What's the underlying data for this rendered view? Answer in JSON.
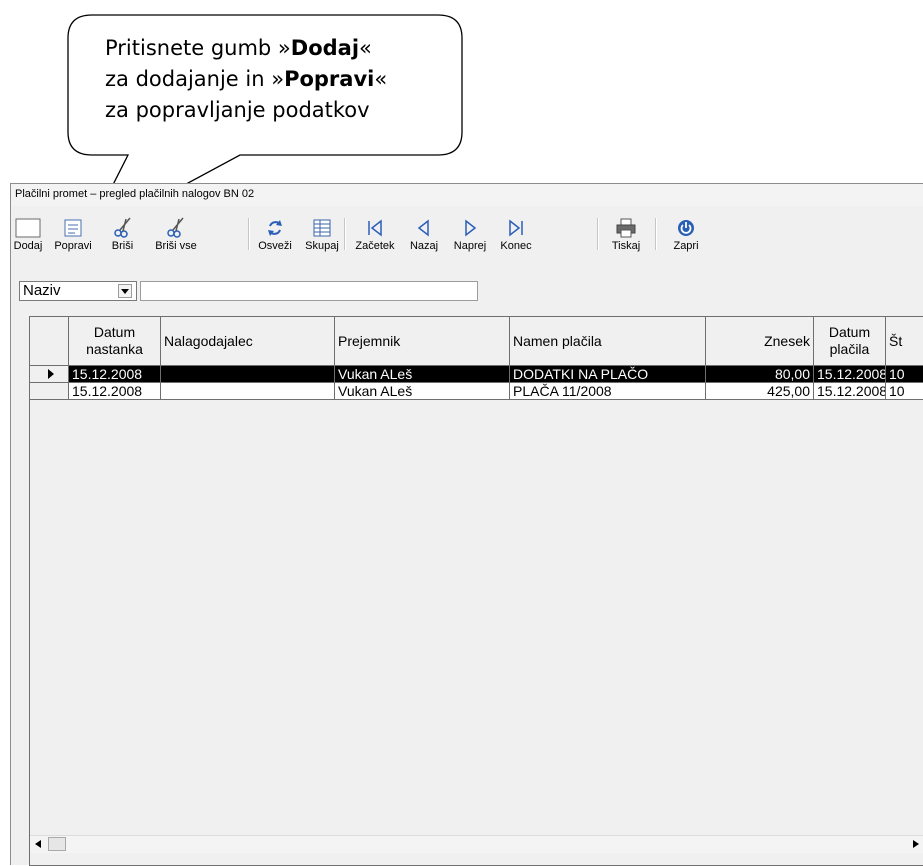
{
  "callout": {
    "line1_pre": "Pritisnete gumb »",
    "line1_bold": "Dodaj",
    "line1_post": "«",
    "line2_pre": "za dodajanje in »",
    "line2_bold": "Popravi",
    "line2_post": "«",
    "line3": "za popravljanje podatkov"
  },
  "window": {
    "title": "Plačilni promet – pregled plačilnih nalogov BN 02"
  },
  "toolbar": {
    "dodaj": "Dodaj",
    "popravi": "Popravi",
    "brisi": "Briši",
    "brisi_vse": "Briši vse",
    "osvezi": "Osveži",
    "skupaj": "Skupaj",
    "zacetek": "Začetek",
    "nazaj": "Nazaj",
    "naprej": "Naprej",
    "konec": "Konec",
    "tiskaj": "Tiskaj",
    "zapri": "Zapri"
  },
  "filter": {
    "field": "Naziv",
    "value": ""
  },
  "grid": {
    "columns": {
      "datum_nastanka_1": "Datum",
      "datum_nastanka_2": "nastanka",
      "nalagodajalec": "Nalagodajalec",
      "prejemnik": "Prejemnik",
      "namen": "Namen plačila",
      "znesek": "Znesek",
      "datum_placila_1": "Datum",
      "datum_placila_2": "plačila",
      "st": "Št"
    },
    "rows": [
      {
        "datum": "15.12.2008",
        "nalagodajalec": "",
        "prejemnik": "Vukan ALeš",
        "namen": "DODATKI NA PLAČO",
        "znesek": "80,00",
        "datum_placila": "15.12.2008",
        "st": "10"
      },
      {
        "datum": "15.12.2008",
        "nalagodajalec": "",
        "prejemnik": "Vukan ALeš",
        "namen": "PLAČA 11/2008",
        "znesek": "425,00",
        "datum_placila": "15.12.2008",
        "st": "10"
      }
    ]
  },
  "colors": {
    "selected_row": "#000000",
    "window_bg": "#f0f0f0",
    "icon_blue": "#2a5fb8"
  }
}
